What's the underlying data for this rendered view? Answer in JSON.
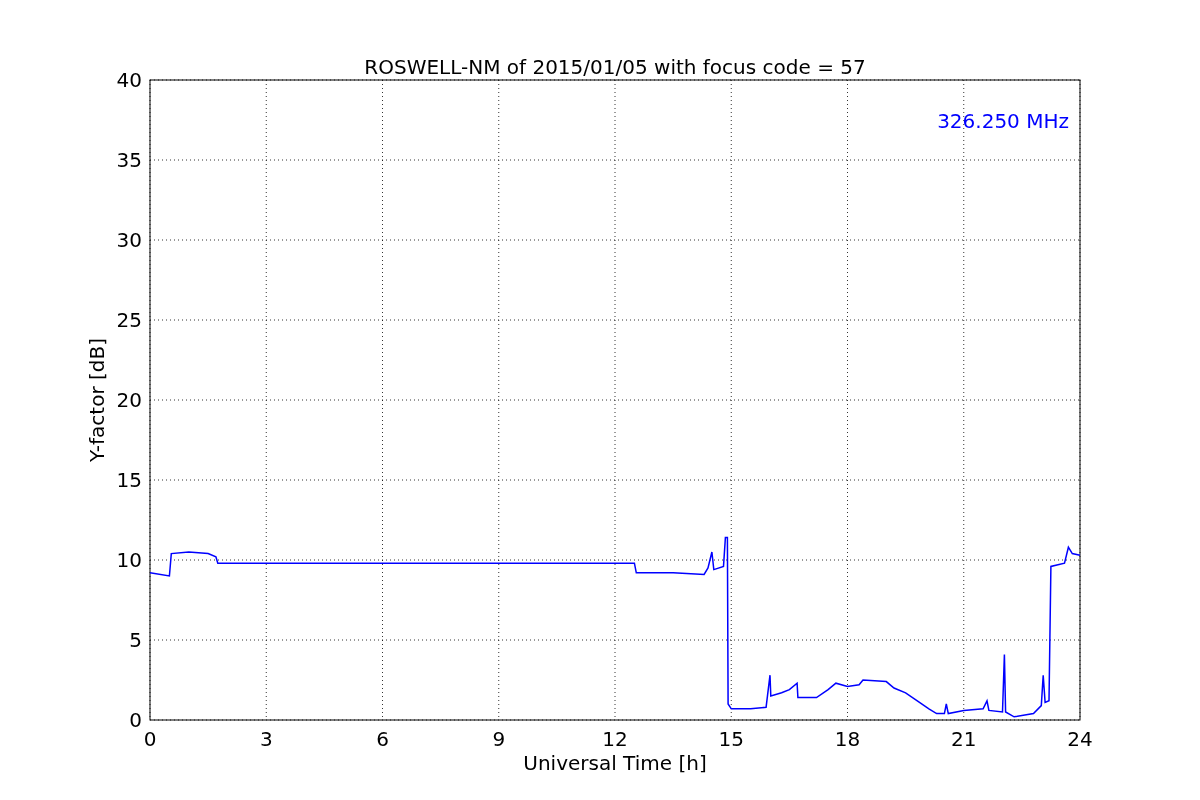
{
  "chart_data": {
    "type": "line",
    "title": "ROSWELL-NM of 2015/01/05 with focus code = 57",
    "xlabel": "Universal Time [h]",
    "ylabel": "Y-factor [dB]",
    "x": [
      0,
      0.5,
      0.55,
      1.0,
      1.5,
      1.7,
      1.75,
      12.5,
      12.55,
      13.5,
      14.3,
      14.4,
      14.5,
      14.55,
      14.8,
      14.85,
      14.9,
      14.92,
      15.0,
      15.5,
      15.9,
      16.0,
      16.02,
      16.3,
      16.5,
      16.7,
      16.72,
      17.2,
      17.5,
      17.7,
      18.0,
      18.3,
      18.4,
      19.0,
      19.2,
      19.5,
      19.8,
      20.1,
      20.3,
      20.5,
      20.55,
      20.6,
      21.0,
      21.5,
      21.6,
      21.65,
      22.0,
      22.05,
      22.08,
      22.3,
      22.8,
      23.0,
      23.05,
      23.1,
      23.2,
      23.25,
      23.6,
      23.7,
      23.8,
      24.0
    ],
    "series": [
      {
        "name": "326.250 MHz",
        "color": "#0000ff",
        "values": [
          9.2,
          9.0,
          10.4,
          10.5,
          10.4,
          10.2,
          9.8,
          9.8,
          9.2,
          9.2,
          9.1,
          9.5,
          10.5,
          9.4,
          9.6,
          11.4,
          11.4,
          1.0,
          0.7,
          0.7,
          0.8,
          2.8,
          1.5,
          1.7,
          1.9,
          2.3,
          1.4,
          1.4,
          1.9,
          2.3,
          2.1,
          2.2,
          2.5,
          2.4,
          2.0,
          1.7,
          1.2,
          0.7,
          0.4,
          0.4,
          1.0,
          0.4,
          0.6,
          0.7,
          1.2,
          0.6,
          0.5,
          4.1,
          0.5,
          0.2,
          0.4,
          0.9,
          2.8,
          1.1,
          1.2,
          9.6,
          9.8,
          10.8,
          10.4,
          10.3
        ]
      }
    ],
    "xlim": [
      0,
      24
    ],
    "ylim": [
      0,
      40
    ],
    "xticks": [
      0,
      3,
      6,
      9,
      12,
      15,
      18,
      21,
      24
    ],
    "yticks": [
      0,
      5,
      10,
      15,
      20,
      25,
      30,
      35,
      40
    ],
    "grid": true
  }
}
